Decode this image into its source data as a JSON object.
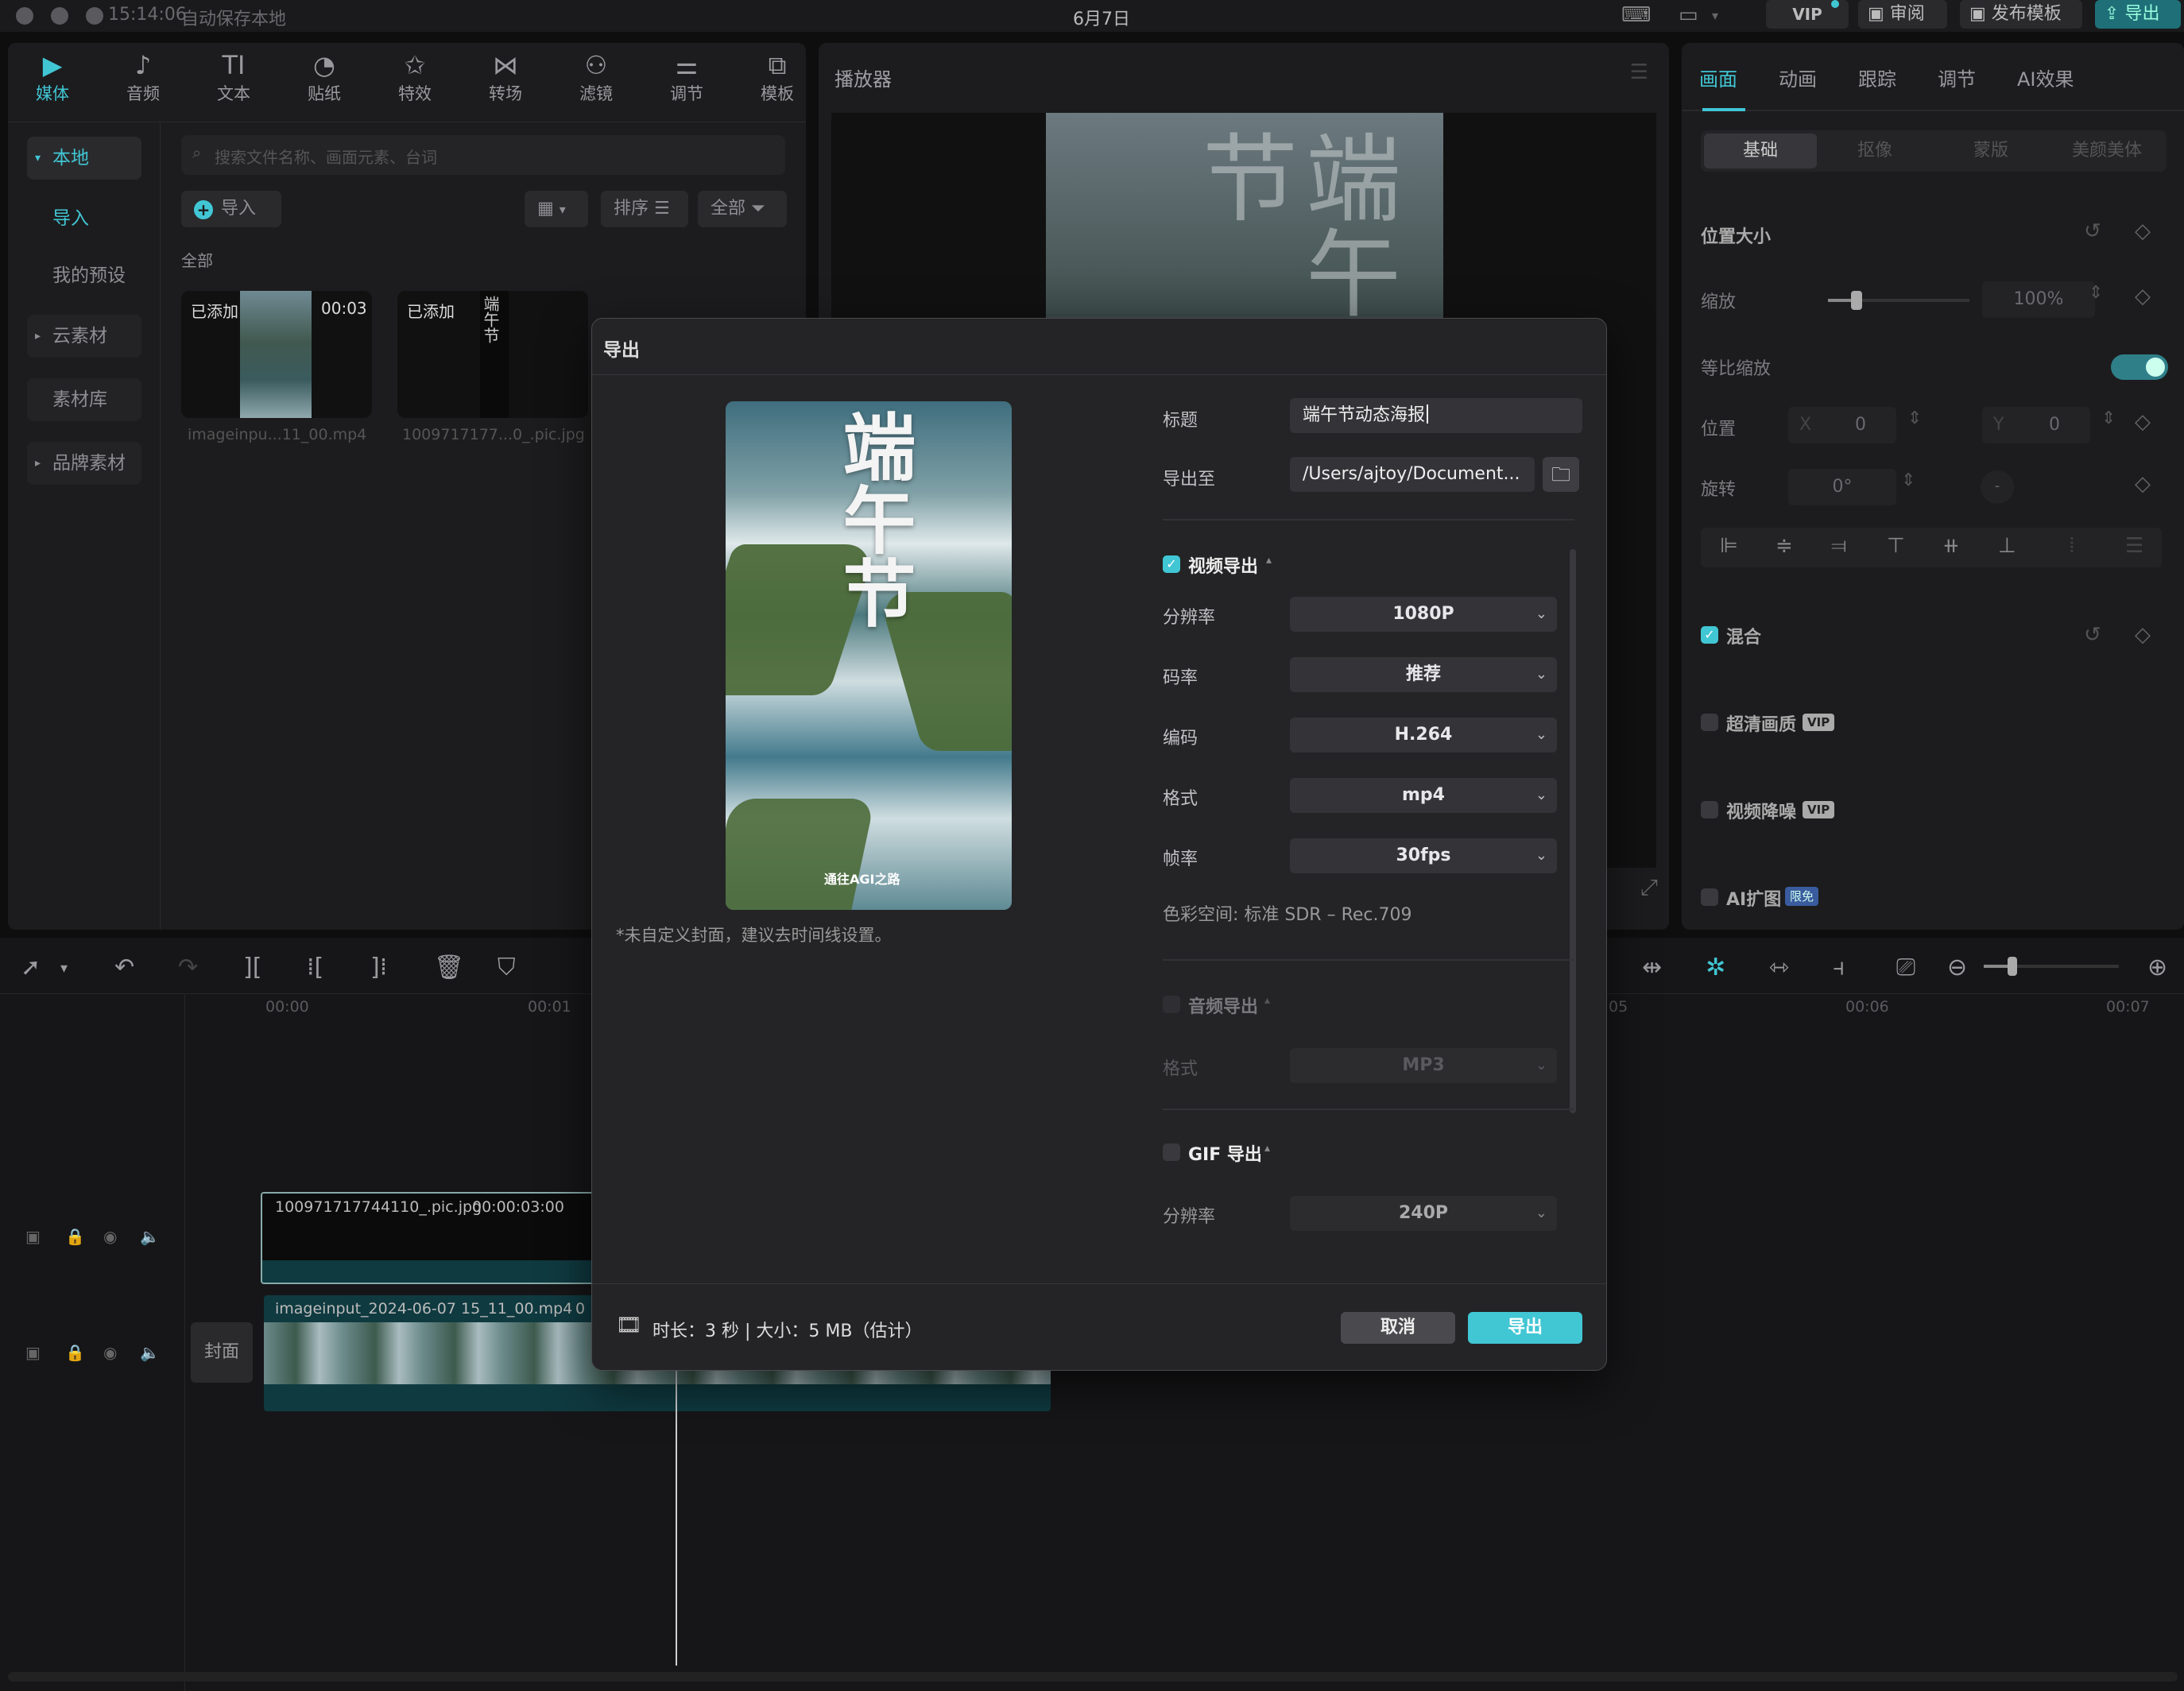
{
  "topbar": {
    "time": "15:14:06",
    "autosave": "自动保存本地",
    "date": "6月7日",
    "vip": "VIP",
    "review": "审阅",
    "publish_template": "发布模板",
    "export": "导出"
  },
  "toolbar": {
    "items": [
      {
        "label": "媒体",
        "icon": "play-square-icon"
      },
      {
        "label": "音频",
        "icon": "music-note-icon"
      },
      {
        "label": "文本",
        "icon": "text-icon"
      },
      {
        "label": "贴纸",
        "icon": "sticker-icon"
      },
      {
        "label": "特效",
        "icon": "sparkle-star-icon"
      },
      {
        "label": "转场",
        "icon": "bowtie-icon"
      },
      {
        "label": "滤镜",
        "icon": "filter-circles-icon"
      },
      {
        "label": "调节",
        "icon": "sliders-icon"
      },
      {
        "label": "模板",
        "icon": "template-icon"
      }
    ]
  },
  "media_sidebar": {
    "local": "本地",
    "import": "导入",
    "my_presets": "我的预设",
    "cloud": "云素材",
    "library": "素材库",
    "brand": "品牌素材"
  },
  "media": {
    "search_placeholder": "搜索文件名称、画面元素、台词",
    "import_button": "导入",
    "sort": "排序",
    "filter": "全部",
    "section": "全部",
    "items": [
      {
        "badge": "已添加",
        "duration": "00:03",
        "name": "imageinpu...11_00.mp4"
      },
      {
        "badge": "已添加",
        "duration": "",
        "name": "1009717177...0_.pic.jpg"
      }
    ]
  },
  "player": {
    "title": "播放器"
  },
  "inspector": {
    "tabs": [
      "画面",
      "动画",
      "跟踪",
      "调节",
      "AI效果"
    ],
    "subtabs": [
      "基础",
      "抠像",
      "蒙版",
      "美颜美体"
    ],
    "position_size": "位置大小",
    "scale_label": "缩放",
    "scale_value": "100%",
    "scale_fraction": 0.2,
    "uniform_label": "等比缩放",
    "position_label": "位置",
    "x_label": "X",
    "x_value": "0",
    "y_label": "Y",
    "y_value": "0",
    "rotate_label": "旋转",
    "rotate_value": "0°",
    "blend": "混合",
    "hd": "超清画质",
    "denoise": "视频降噪",
    "ai_expand": "AI扩图",
    "vip_badge": "VIP",
    "free_badge": "限免"
  },
  "timeline": {
    "ruler": [
      "00:00",
      "00:01",
      "00:06",
      "00:07"
    ],
    "ruler_partial": "05",
    "clip_image": "100971717744110_.pic.jpg",
    "clip_image_duration": "00:00:03:00",
    "clip_video": "imageinput_2024-06-07 15_11_00.mp4",
    "clip_video_suffix": "0",
    "cover": "封面"
  },
  "dialog": {
    "title": "导出",
    "cover_note": "*未自定义封面，建议去时间线设置。",
    "poster_title": "端午节",
    "poster_logo": "通往AGI之路",
    "title_label": "标题",
    "title_value": "端午节动态海报",
    "export_to_label": "导出至",
    "export_path": "/Users/ajtoy/Document...",
    "video_export": "视频导出",
    "resolution_label": "分辨率",
    "resolution_value": "1080P",
    "bitrate_label": "码率",
    "bitrate_value": "推荐",
    "codec_label": "编码",
    "codec_value": "H.264",
    "format_label": "格式",
    "format_value": "mp4",
    "framerate_label": "帧率",
    "framerate_value": "30fps",
    "colorspace": "色彩空间:  标准 SDR – Rec.709",
    "audio_export": "音频导出",
    "audio_format_label": "格式",
    "audio_format_value": "MP3",
    "gif_export": "GIF 导出",
    "gif_resolution_label": "分辨率",
    "gif_resolution_value": "240P",
    "footer_info": "时长：3 秒 | 大小：5 MB（估计）",
    "cancel": "取消",
    "export": "导出"
  }
}
